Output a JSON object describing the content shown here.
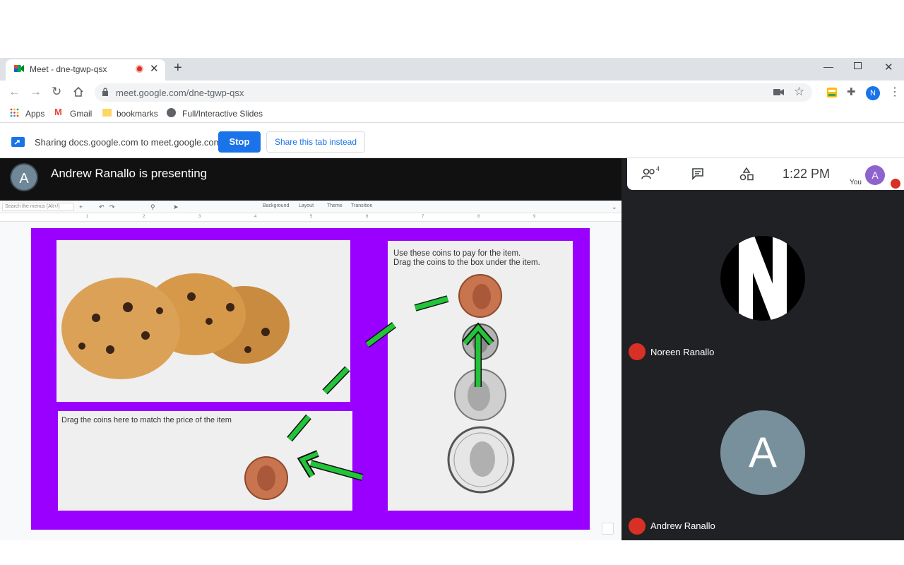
{
  "browser": {
    "tab_title": "Meet - dne-tgwp-qsx",
    "url": "meet.google.com/dne-tgwp-qsx",
    "new_tab_symbol": "+",
    "bookmarks": [
      "Apps",
      "Gmail",
      "bookmarks",
      "Full/Interactive Slides"
    ],
    "profile_initial": "N"
  },
  "share_bar": {
    "text": "Sharing docs.google.com to meet.google.com",
    "stop_label": "Stop",
    "share_tab_label": "Share this tab instead"
  },
  "meet": {
    "presenter_initial": "A",
    "presenting_text": "Andrew Ranallo is presenting",
    "participants_count": "4",
    "time": "1:22 PM",
    "self_label": "You",
    "self_initial": "A",
    "participants": [
      {
        "name": "Noreen Ranallo",
        "initial": "N"
      },
      {
        "name": "Andrew Ranallo",
        "initial": "A"
      }
    ]
  },
  "slides_editor": {
    "search_placeholder": "Search the menus (Alt+/)",
    "toolbar_items": [
      "Background",
      "Layout",
      "Theme",
      "Transition"
    ],
    "ruler_numbers": [
      "1",
      "2",
      "3",
      "4",
      "5",
      "6",
      "7",
      "8",
      "9"
    ]
  },
  "slide": {
    "background_color": "#9900ff",
    "drop_text": "Drag the coins here to match the price of the item",
    "coins_text_line1": "Use these coins to pay for the item.",
    "coins_text_line2": "Drag the coins  to the box under the item.",
    "arrow_color": "#22c43a"
  },
  "colors": {
    "stop_button": "#1a73e8",
    "mic_off": "#d93025"
  }
}
